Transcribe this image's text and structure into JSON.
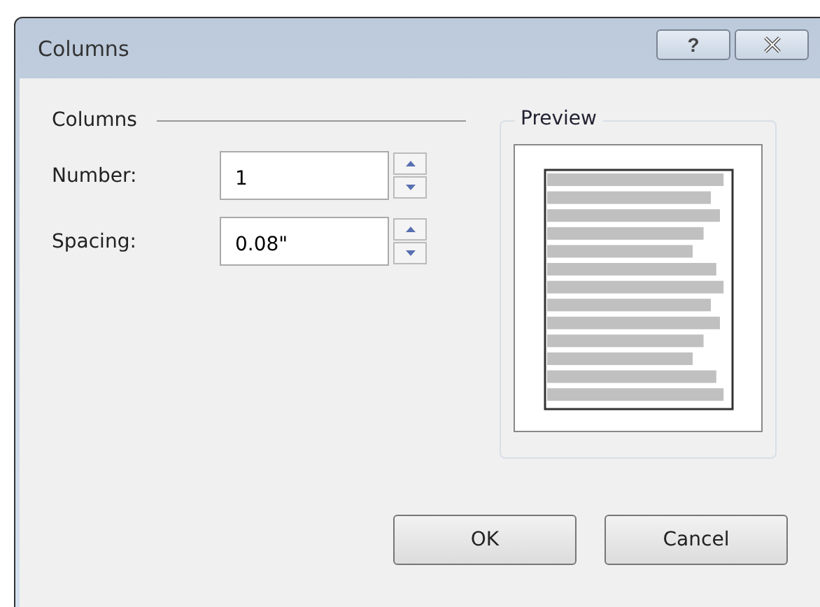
{
  "window": {
    "title": "Columns",
    "help_button": "?"
  },
  "columns_section": {
    "heading": "Columns",
    "fields": [
      {
        "label": "Number:",
        "value": "1"
      },
      {
        "label": "Spacing:",
        "value": "0.08\""
      }
    ]
  },
  "preview": {
    "heading": "Preview"
  },
  "buttons": [
    "OK",
    "Cancel"
  ]
}
